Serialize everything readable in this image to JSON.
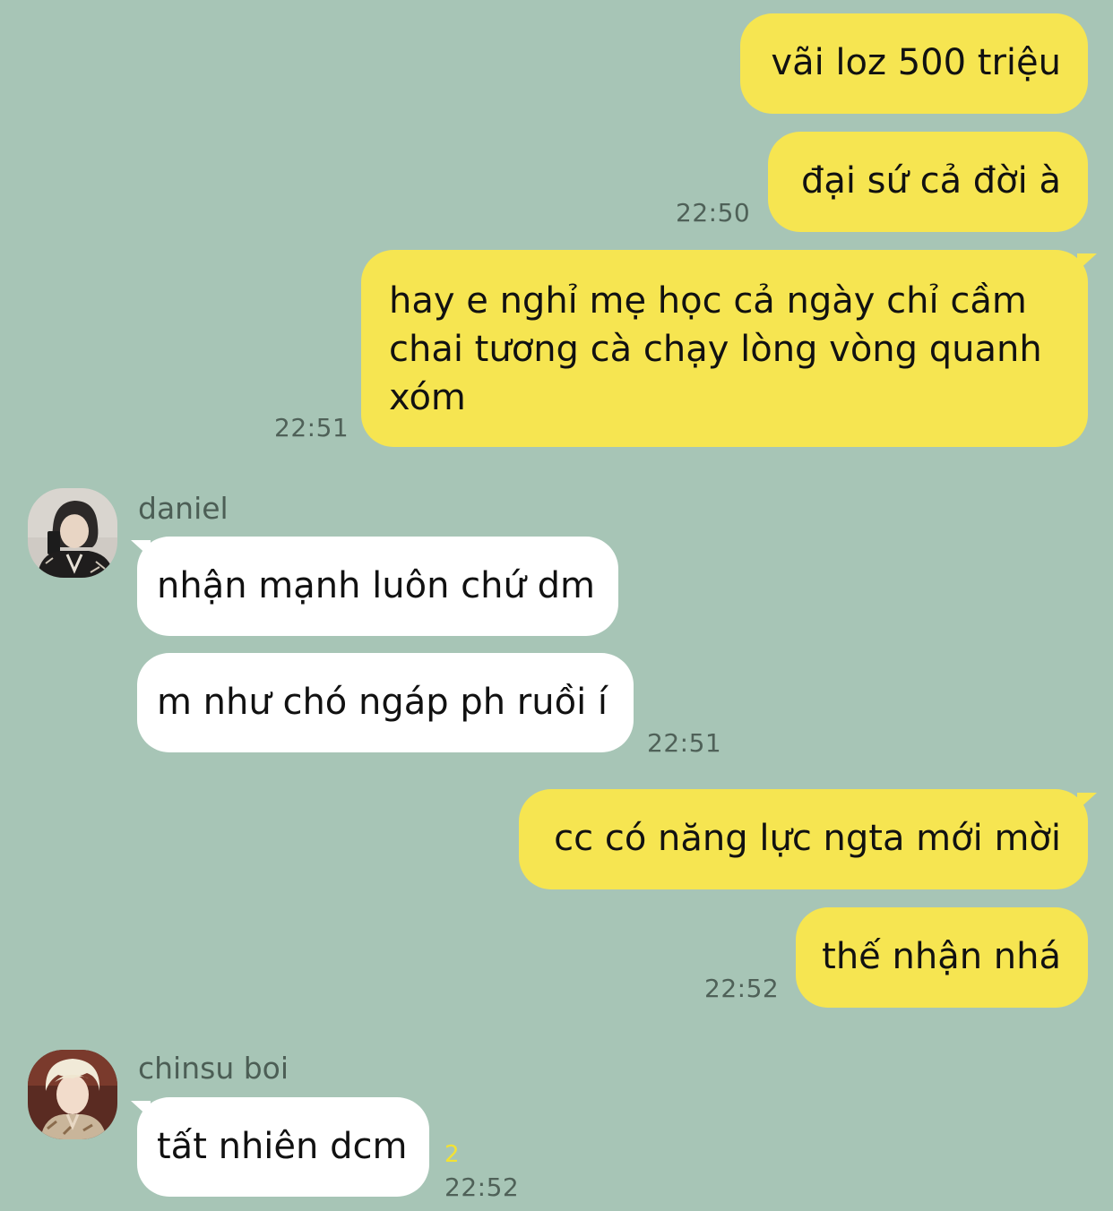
{
  "theme": {
    "background": "#a7c5b6",
    "sent_bubble": "#f6e551",
    "received_bubble": "#ffffff",
    "unread_color": "#f3e233"
  },
  "messages": {
    "m1": "vãi loz 500 triệu",
    "m2": "đại sứ cả đời à",
    "m2_time": "22:50",
    "m3": "hay e nghỉ mẹ học cả ngày chỉ cầm chai tương cà chạy lòng vòng quanh xóm",
    "m3_time": "22:51",
    "daniel_name": "daniel",
    "m4": "nhận mạnh luôn chứ dm",
    "m5": "m như chó ngáp ph ruồi í",
    "m5_time": "22:51",
    "m6": "cc có năng lực ngta mới mời",
    "m7": "thế nhận nhá",
    "m7_time": "22:52",
    "chinsu_name": "chinsu boi",
    "m8": "tất nhiên dcm",
    "m8_unread": "2",
    "m8_time": "22:52"
  },
  "avatars": {
    "daniel": "profile-photo",
    "chinsu": "profile-photo"
  }
}
